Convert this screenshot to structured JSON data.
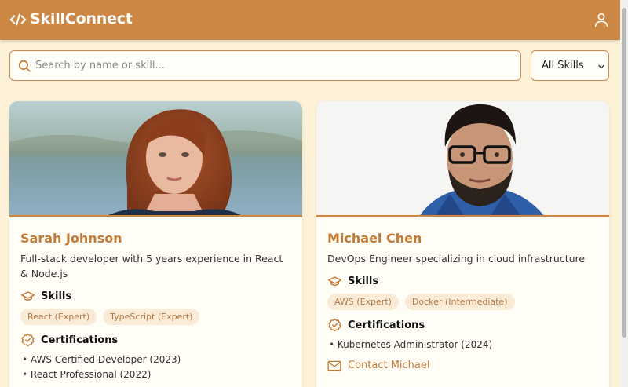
{
  "app": {
    "title": "SkillConnect"
  },
  "search": {
    "placeholder": "Search by name or skill..."
  },
  "filter": {
    "selected": "All Skills"
  },
  "profiles": [
    {
      "name": "Sarah Johnson",
      "bio": "Full-stack developer with 5 years experience in React & Node.js",
      "skills_heading": "Skills",
      "skills": [
        "React (Expert)",
        "TypeScript (Expert)"
      ],
      "certs_heading": "Certifications",
      "certifications": [
        "AWS Certified Developer (2023)",
        "React Professional (2022)"
      ]
    },
    {
      "name": "Michael Chen",
      "bio": "DevOps Engineer specializing in cloud infrastructure",
      "skills_heading": "Skills",
      "skills": [
        "AWS (Expert)",
        "Docker (Intermediate)"
      ],
      "certs_heading": "Certifications",
      "certifications": [
        "Kubernetes Administrator (2024)"
      ],
      "contact_label": "Contact Michael"
    }
  ],
  "colors": {
    "header": "#cd8744",
    "background": "#fdf2d8",
    "accent": "#c27a34",
    "tag_bg": "#faebd6"
  },
  "icons": [
    "code-icon",
    "user-icon",
    "search-icon",
    "chevron-down-icon",
    "graduation-cap-icon",
    "certificate-badge-icon",
    "mail-icon"
  ]
}
